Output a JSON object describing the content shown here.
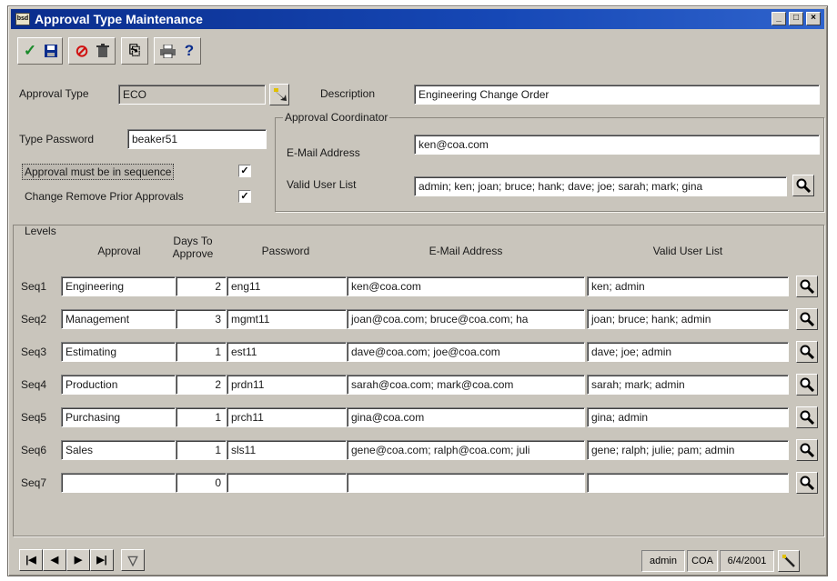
{
  "window": {
    "title": "Approval Type Maintenance",
    "app_icon_text": "bsd"
  },
  "toolbar": {
    "items": [
      {
        "name": "save-check",
        "glyph": "✓",
        "color": "#1a8a2a"
      },
      {
        "name": "save-disk",
        "glyph": "■",
        "color": "#0a2d8c"
      },
      {
        "name": "cancel",
        "glyph": "⊘",
        "color": "#d01010"
      },
      {
        "name": "delete-trash",
        "glyph": "♜",
        "color": "#333333"
      },
      {
        "name": "copy",
        "glyph": "⎘",
        "color": "#333333"
      },
      {
        "name": "print",
        "glyph": "⎙",
        "color": "#333333"
      },
      {
        "name": "help",
        "glyph": "?",
        "color": "#0a2d8c"
      }
    ]
  },
  "header": {
    "approval_type_label": "Approval Type",
    "approval_type_value": "ECO",
    "description_label": "Description",
    "description_value": "Engineering Change Order",
    "type_password_label": "Type Password",
    "type_password_value": "beaker51",
    "sequence_label": "Approval must be in sequence",
    "sequence_checked": "✓",
    "change_remove_label": "Change Remove Prior Approvals",
    "change_remove_checked": "✓"
  },
  "coordinator": {
    "group_label": "Approval Coordinator",
    "email_label": "E-Mail Address",
    "email_value": "ken@coa.com",
    "user_list_label": "Valid User List",
    "user_list_value": "admin; ken; joan; bruce; hank; dave; joe; sarah; mark; gina"
  },
  "levels": {
    "group_label": "Levels",
    "columns": {
      "approval": "Approval",
      "days_to_approve": "Days To Approve",
      "password": "Password",
      "email": "E-Mail Address",
      "user_list": "Valid User List"
    },
    "rows": [
      {
        "seq": "Seq1",
        "approval": "Engineering",
        "days": "2",
        "password": "eng11",
        "email": "ken@coa.com",
        "users": "ken; admin"
      },
      {
        "seq": "Seq2",
        "approval": "Management",
        "days": "3",
        "password": "mgmt11",
        "email": "joan@coa.com; bruce@coa.com; ha",
        "users": "joan; bruce; hank; admin"
      },
      {
        "seq": "Seq3",
        "approval": "Estimating",
        "days": "1",
        "password": "est11",
        "email": "dave@coa.com; joe@coa.com",
        "users": "dave; joe; admin"
      },
      {
        "seq": "Seq4",
        "approval": "Production",
        "days": "2",
        "password": "prdn11",
        "email": "sarah@coa.com;  mark@coa.com",
        "users": "sarah; mark; admin"
      },
      {
        "seq": "Seq5",
        "approval": "Purchasing",
        "days": "1",
        "password": "prch11",
        "email": "gina@coa.com",
        "users": "gina; admin"
      },
      {
        "seq": "Seq6",
        "approval": "Sales",
        "days": "1",
        "password": "sls11",
        "email": "gene@coa.com; ralph@coa.com; juli",
        "users": "gene; ralph; julie; pam; admin"
      },
      {
        "seq": "Seq7",
        "approval": "",
        "days": "0",
        "password": "",
        "email": "",
        "users": ""
      }
    ]
  },
  "navigation": {
    "first": "|◀",
    "prev": "◀",
    "next": "▶",
    "last": "▶|",
    "filter": "▽"
  },
  "statusbar": {
    "user": "admin",
    "company": "COA",
    "date": "6/4/2001"
  },
  "colors": {
    "title_bar": "#0a2d8c",
    "window_bg": "#c9c5bc"
  }
}
